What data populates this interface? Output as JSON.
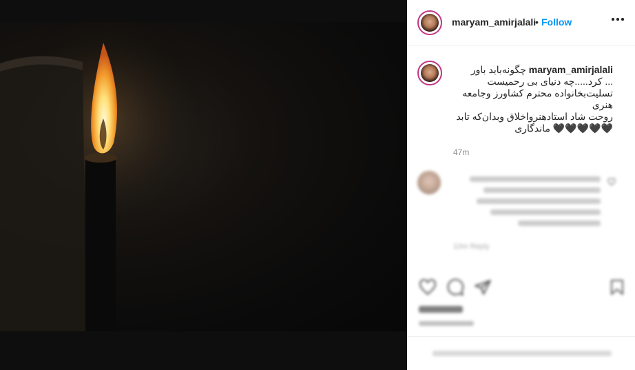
{
  "post": {
    "username": "maryam_amirjalali",
    "separator": "•",
    "follow_label": "Follow",
    "caption_username": "maryam_amirjalali",
    "caption_lines": [
      "چگونه‌باید باور",
      "... کرد.....چه دنیای بی رحمیست",
      "تسلیت‌بخانواده محترم کشاورز وجامعه",
      "هنری",
      "روحت شاد استادهنرواخلاق وبدان‌که تابد",
      "🖤🖤🖤🖤🖤 ماندگاری"
    ],
    "posted_ago": "47m"
  },
  "blurred_comment": {
    "meta": "10m   Reply"
  },
  "icons": {
    "more": "more-options-icon",
    "like": "heart-icon",
    "comment": "comment-icon",
    "share": "share-icon",
    "save": "bookmark-icon"
  },
  "colors": {
    "follow": "#0095f6",
    "text": "#262626",
    "muted": "#8e8e8e",
    "border": "#efefef",
    "story_ring": "#c13584"
  }
}
